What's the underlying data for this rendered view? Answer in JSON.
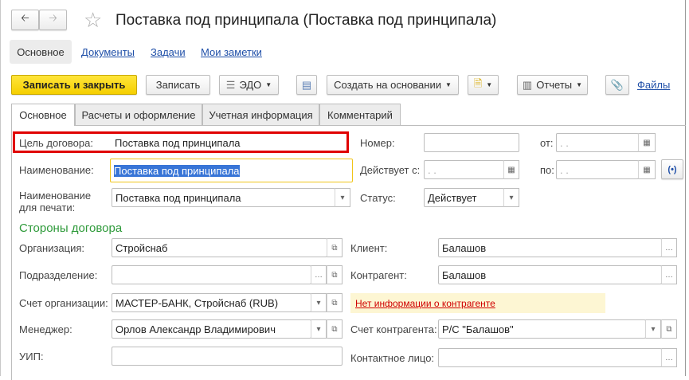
{
  "title": "Поставка под принципала (Поставка под принципала)",
  "nav": {
    "back": "back-arrow",
    "forward": "forward-arrow",
    "items": [
      "Основное",
      "Документы",
      "Задачи",
      "Мои заметки"
    ]
  },
  "toolbar": {
    "save_close": "Записать и закрыть",
    "save": "Записать",
    "edo": "ЭДО",
    "create_based": "Создать на основании",
    "reports": "Отчеты",
    "files": "Файлы"
  },
  "tabs": [
    "Основное",
    "Расчеты и оформление",
    "Учетная информация",
    "Комментарий"
  ],
  "form": {
    "goal_label": "Цель договора:",
    "goal_value": "Поставка под принципала",
    "number_label": "Номер:",
    "number_value": "",
    "from_label": "от:",
    "from_value": " .  .",
    "name_label": "Наименование:",
    "name_value": "Поставка под принципала",
    "valid_from_label": "Действует с:",
    "valid_from_value": " .  .",
    "to_label": "по:",
    "to_value": " .  .",
    "print_name_label_1": "Наименование",
    "print_name_label_2": "для печати:",
    "print_name_value": "Поставка под принципала",
    "status_label": "Статус:",
    "status_value": "Действует",
    "section": "Стороны договора",
    "org_label": "Организация:",
    "org_value": "Стройснаб",
    "client_label": "Клиент:",
    "client_value": "Балашов",
    "dept_label": "Подразделение:",
    "dept_value": "",
    "counterparty_label": "Контрагент:",
    "counterparty_value": "Балашов",
    "org_account_label": "Счет организации:",
    "org_account_value": "МАСТЕР-БАНК, Стройснаб (RUB)",
    "notice": "Нет информации о контрагенте",
    "manager_label": "Менеджер:",
    "manager_value": "Орлов Александр Владимирович",
    "cp_account_label": "Счет контрагента:",
    "cp_account_value": "Р/С \"Балашов\"",
    "uip_label": "УИП:",
    "uip_value": "",
    "contact_label": "Контактное лицо:",
    "contact_value": ""
  },
  "colors": {
    "primary": "#f5cf00",
    "section": "#2e9a3a",
    "highlight_border": "#e00000",
    "notice_bg": "#fdf6d3",
    "link": "#1f4fa8"
  }
}
